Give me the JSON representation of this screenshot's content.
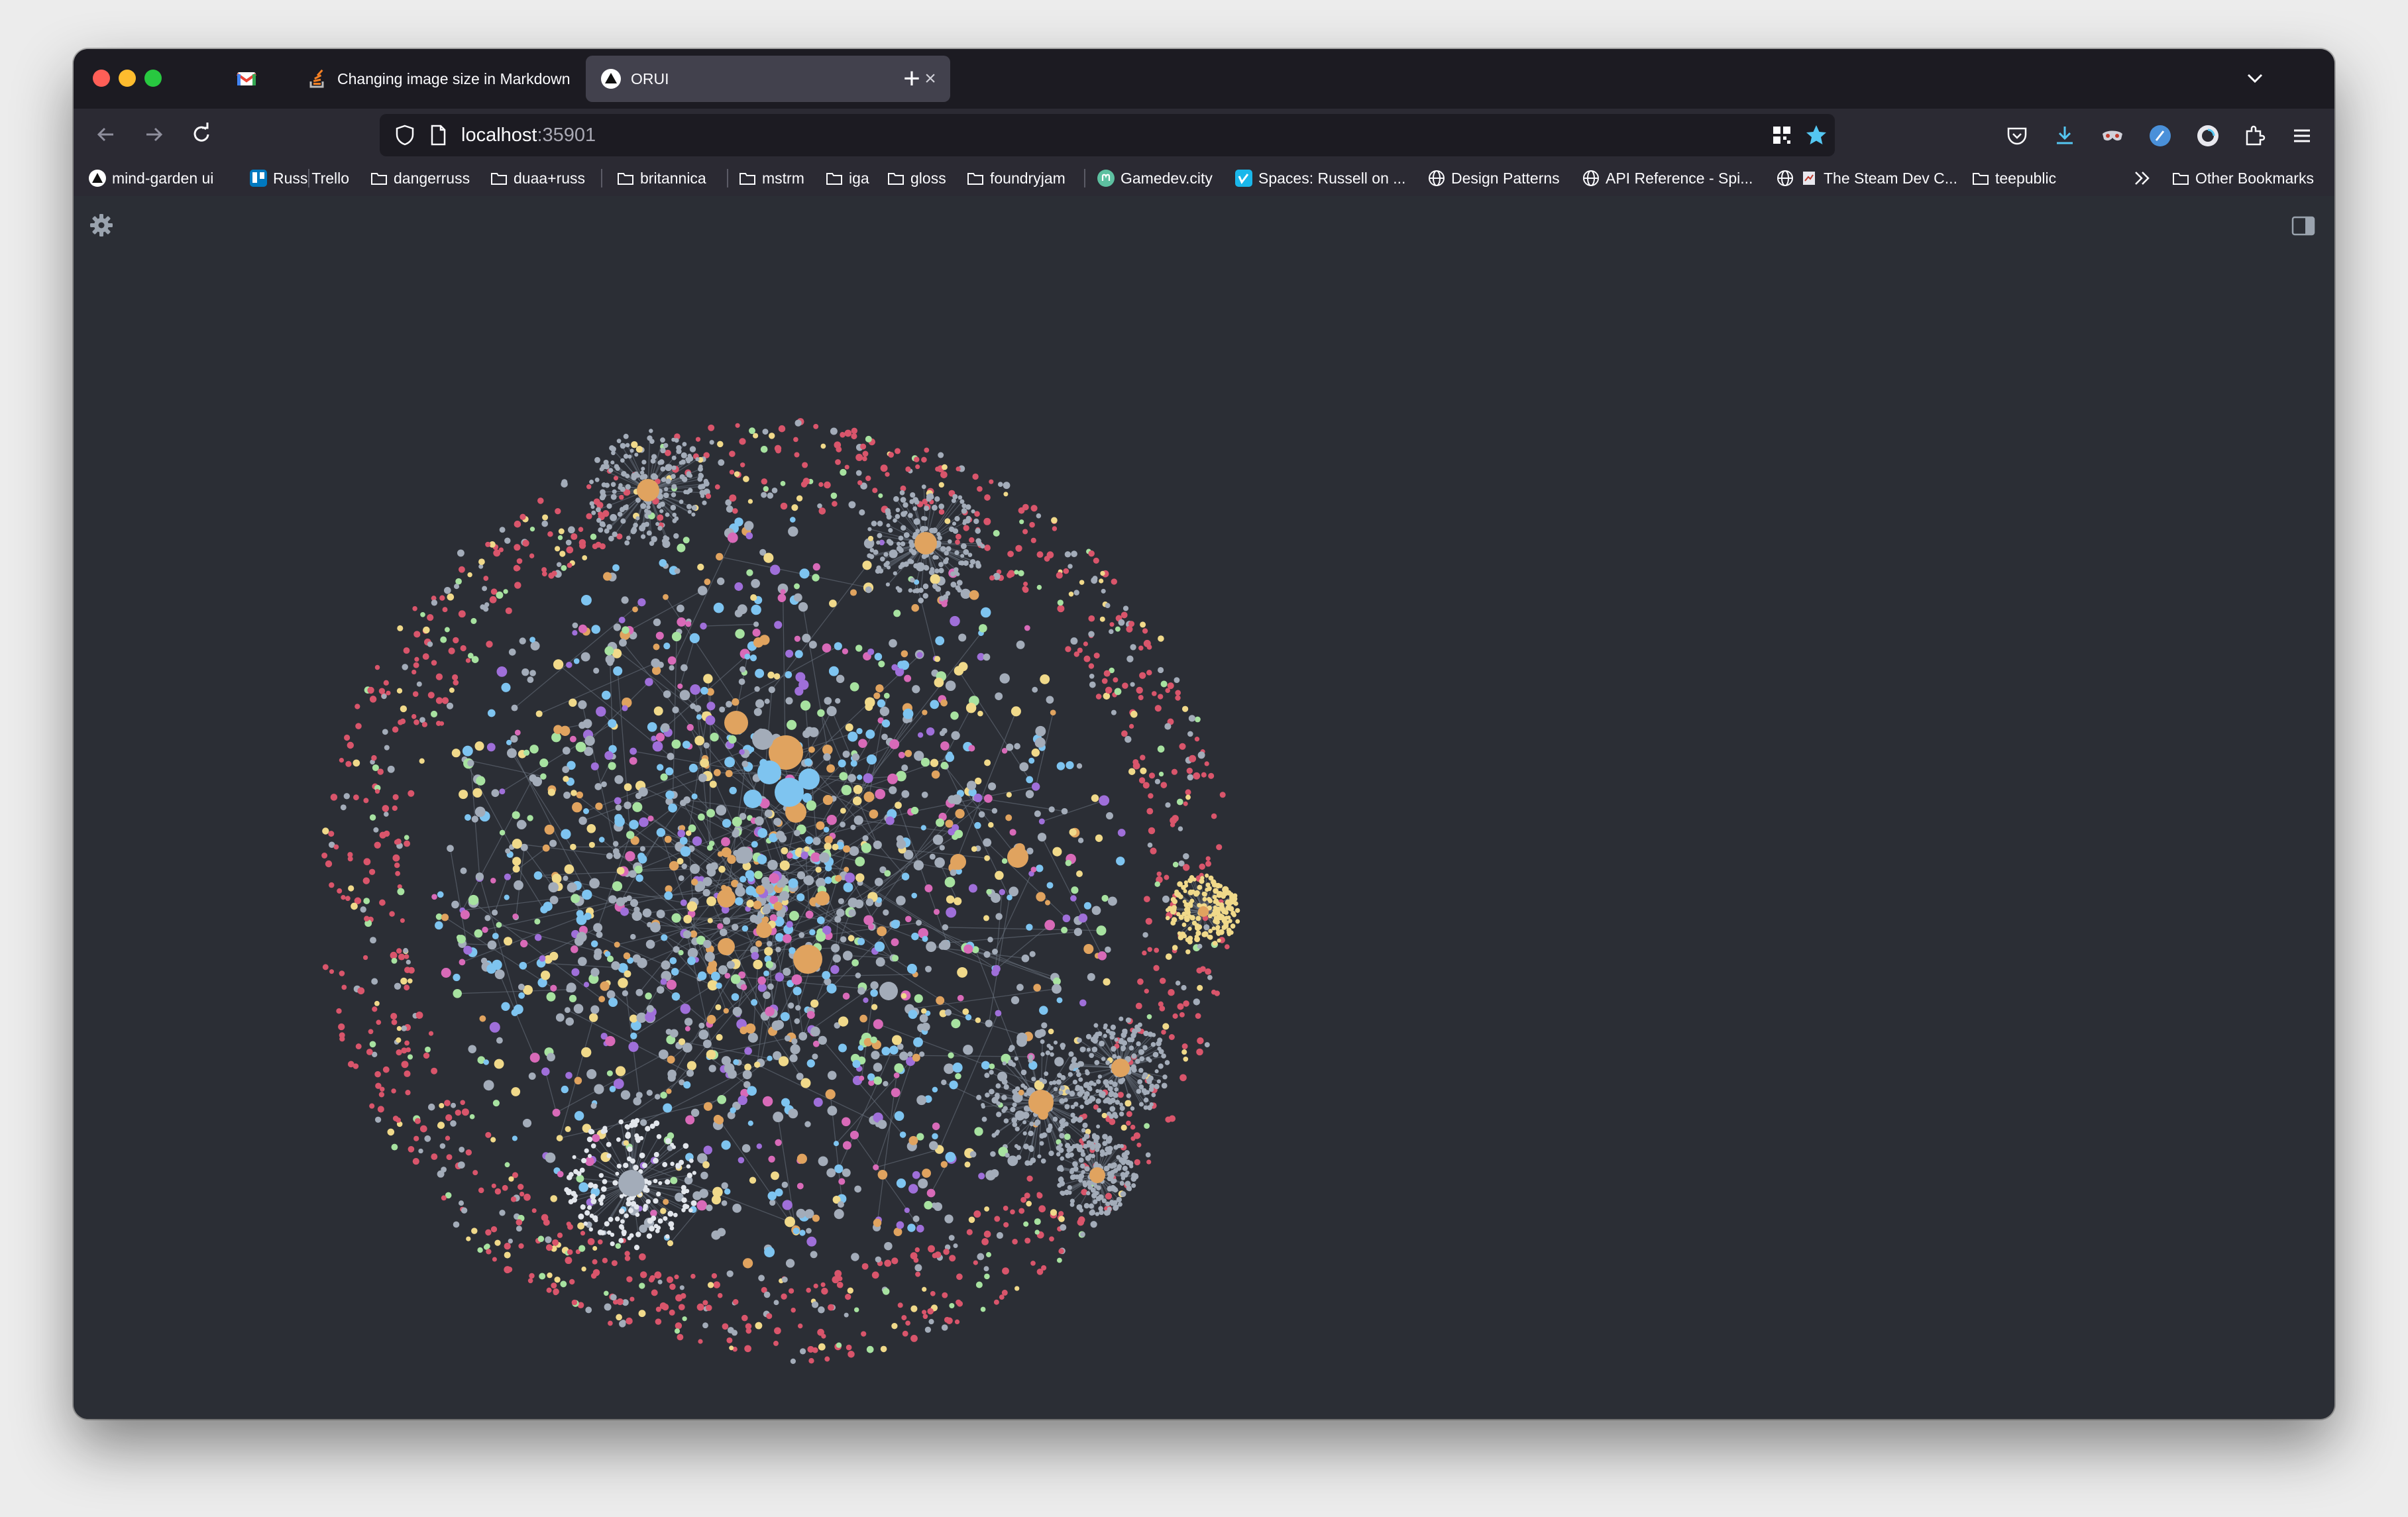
{
  "browser": {
    "tabs": [
      {
        "title": "",
        "favicon": "gmail-icon",
        "pinned": true
      },
      {
        "title": "Changing image size in Markdown",
        "favicon": "stackoverflow-icon",
        "closable": true
      },
      {
        "title": "ORUI",
        "favicon": "orui-triangle-icon",
        "active": true,
        "closable": true
      }
    ],
    "new_tab": "+",
    "url": {
      "host": "localhost",
      "port": ":35901"
    }
  },
  "bookmarks": [
    {
      "label": "mind-garden ui",
      "icon": "triangle-logo-icon"
    },
    {
      "label": "Russ Trello",
      "icon": "trello-icon"
    },
    {
      "label": "dangerruss",
      "icon": "folder-icon"
    },
    {
      "label": "duaa+russ",
      "icon": "folder-icon"
    },
    {
      "label": "britannica",
      "icon": "folder-icon"
    },
    {
      "label": "mstrm",
      "icon": "folder-icon"
    },
    {
      "label": "iga",
      "icon": "folder-icon"
    },
    {
      "label": "gloss",
      "icon": "folder-icon"
    },
    {
      "label": "foundryjam",
      "icon": "folder-icon"
    },
    {
      "label": "Gamedev.city",
      "icon": "mastodon-icon"
    },
    {
      "label": "Spaces: Russell on ...",
      "icon": "vimeo-icon"
    },
    {
      "label": "Design Patterns",
      "icon": "globe-icon"
    },
    {
      "label": "API Reference - Spi...",
      "icon": "globe-icon"
    },
    {
      "label": "The Steam Dev C...",
      "icon": "globe-icon"
    },
    {
      "label": "teepublic",
      "icon": "folder-icon"
    }
  ],
  "bookmarks_other": "Other Bookmarks",
  "colors": {
    "background": "#2b2e35",
    "edge": "#6b7480",
    "node_gray": "#a3acb9",
    "node_red": "#d9556b",
    "node_orange": "#e0a35f",
    "node_blue": "#7ec4f0",
    "node_green": "#a7e2a0",
    "node_yellow": "#f0d98a",
    "node_purple": "#9f6fd9",
    "node_pink": "#d86ab8"
  },
  "graph_view": {
    "type": "force-directed-network",
    "hubs": [
      {
        "color": "orange",
        "size": "large",
        "cluster": "center"
      },
      {
        "color": "orange",
        "size": "medium",
        "cluster": "top-left"
      },
      {
        "color": "orange",
        "size": "medium",
        "cluster": "top-right"
      },
      {
        "color": "orange",
        "size": "medium",
        "cluster": "bottom-right"
      },
      {
        "color": "gray",
        "size": "medium",
        "cluster": "bottom-left"
      }
    ]
  }
}
